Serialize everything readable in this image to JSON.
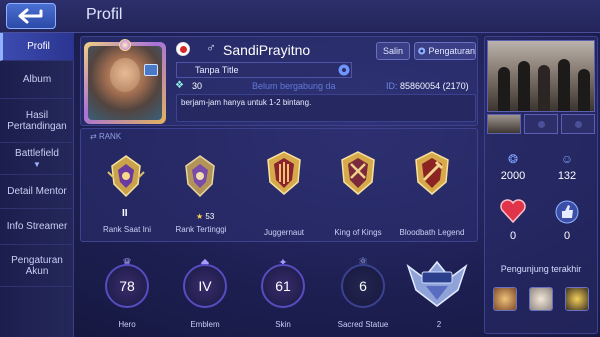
{
  "header": {
    "title": "Profil"
  },
  "sidebar": {
    "items": [
      {
        "label": "Profil",
        "active": true
      },
      {
        "label": "Album"
      },
      {
        "label": "Hasil Pertandingan"
      },
      {
        "label": "Battlefield"
      },
      {
        "label": "Detail Mentor"
      },
      {
        "label": "Info Streamer"
      },
      {
        "label": "Pengaturan Akun"
      }
    ]
  },
  "profile": {
    "username": "SandiPrayitno",
    "copy_label": "Salin",
    "settings_label": "Pengaturan",
    "title": "Tanpa Title",
    "wing_count": "30",
    "squad_status": "Belum bergabung da",
    "id_prefix": "ID:",
    "id_value": "85860054 (2170)",
    "bio": "berjam-jam hanya untuk 1-2 bintang.",
    "flag_color": "#d62828"
  },
  "rank": {
    "header": "RANK",
    "current_tier": "II",
    "highest_stars": "53",
    "badges": [
      {
        "label": "Rank Saat Ini"
      },
      {
        "label": "Rank Tertinggi"
      },
      {
        "label": "Juggernaut"
      },
      {
        "label": "King of Kings"
      },
      {
        "label": "Bloodbath Legend"
      }
    ]
  },
  "stats": [
    {
      "label": "Hero",
      "value": "78",
      "icon": "hero-icon"
    },
    {
      "label": "Emblem",
      "value": "IV",
      "icon": "emblem-icon"
    },
    {
      "label": "Skin",
      "value": "61",
      "icon": "skin-icon"
    },
    {
      "label": "Sacred Statue",
      "value": "6",
      "icon": "statue-icon"
    },
    {
      "label": "2",
      "icon": "mcl-icon"
    }
  ],
  "right_panel": {
    "popularity": "2000",
    "followers": "132",
    "likes_left": "0",
    "likes_right": "0",
    "visitors_label": "Pengunjung terakhir"
  },
  "colors": {
    "accent": "#8fb2ff",
    "background": "#1d1f52",
    "ring": "#574cc0"
  }
}
